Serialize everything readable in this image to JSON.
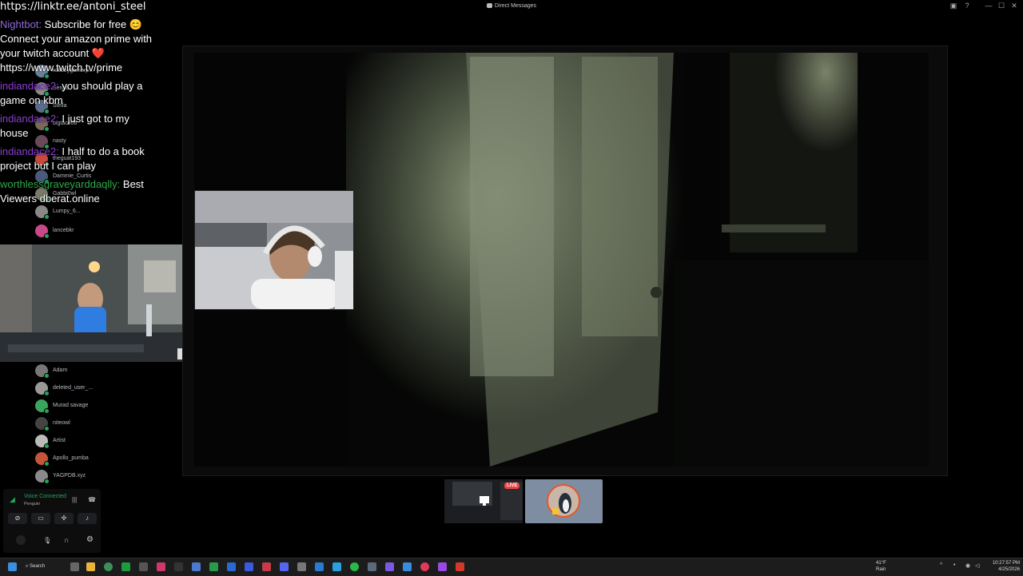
{
  "window": {
    "title": "Direct Messages",
    "controls": {
      "minimize": "—",
      "maximize": "☐",
      "close": "✕"
    }
  },
  "overlay": {
    "url": "https://linktr.ee/antoni_steel"
  },
  "chat": {
    "messages": [
      {
        "user": "Nightbot:",
        "text": "Subscribe for free 😊 Connect your amazon prime with your twitch account ❤️ https://www.twitch.tv/prime",
        "user_color": "#8e6bd8"
      },
      {
        "user": "indiandace2:",
        "text": "you should play a game on kbm",
        "user_color": "#8a3fd0"
      },
      {
        "user": "indiandace2:",
        "text": "I just got to my house",
        "user_color": "#8a3fd0"
      },
      {
        "user": "indiandace2:",
        "text": "I half to do a book project but I can play",
        "user_color": "#8a3fd0"
      },
      {
        "user": "worthlessgraveyarddaqlly:",
        "text": "Best Viewers dberat.online",
        "user_color": "#2fa84a"
      }
    ]
  },
  "members": [
    {
      "name": "ruffboygamerp...",
      "color": "#6b7f9a"
    },
    {
      "name": "Sergio",
      "color": "#8a8a8a"
    },
    {
      "name": "Stella",
      "color": "#5c6b8a"
    },
    {
      "name": "bigtaco08",
      "color": "#7a6a5a"
    },
    {
      "name": "nasty",
      "color": "#6a4a5a"
    },
    {
      "name": "theguat193",
      "color": "#c94a3a"
    },
    {
      "name": "Dammie_Curtis",
      "color": "#4a5a7a"
    },
    {
      "name": "Gabbi0wl",
      "color": "#7a7a6a"
    },
    {
      "name": "Lumpy_6...",
      "color": "#888888"
    },
    {
      "name": "lancebkr",
      "color": "#c9488a"
    },
    {
      "name": "Adam",
      "color": "#777777"
    },
    {
      "name": "deleted_user_...",
      "color": "#999999"
    },
    {
      "name": "Murad savage",
      "color": "#3ba55d"
    },
    {
      "name": "niteowl",
      "color": "#444444"
    },
    {
      "name": "Artist",
      "color": "#bbbbbb"
    },
    {
      "name": "Apollo_pumba",
      "color": "#c4553a"
    },
    {
      "name": "YAGPDB.xyz",
      "color": "#8a8a8a"
    }
  ],
  "stream": {
    "live_badge": "LIVE"
  },
  "voice": {
    "status": "Voice Connected",
    "channel": "Penguin"
  },
  "taskbar": {
    "search": "Search",
    "weather_temp": "41°F",
    "weather_desc": "Rain",
    "time": "10:27:57 PM",
    "date": "4/25/2026"
  }
}
